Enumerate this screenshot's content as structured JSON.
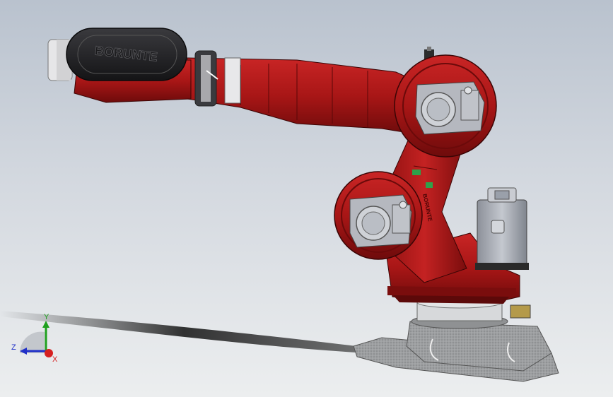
{
  "model": {
    "brand_logo": "BORUNTE",
    "side_marking": "BORUNTE"
  },
  "triad": {
    "x_label": "X",
    "y_label": "Y",
    "z_label": "Z"
  },
  "colors": {
    "robot_red": "#b51a1a",
    "robot_dark_red": "#7a0d0d",
    "cover_black": "#1e1e20",
    "motor_grey": "#a9aeb8",
    "base_grey": "#9b9d9f",
    "axis_x": "#d62020",
    "axis_y": "#1ea01e",
    "axis_z": "#2030c8"
  }
}
